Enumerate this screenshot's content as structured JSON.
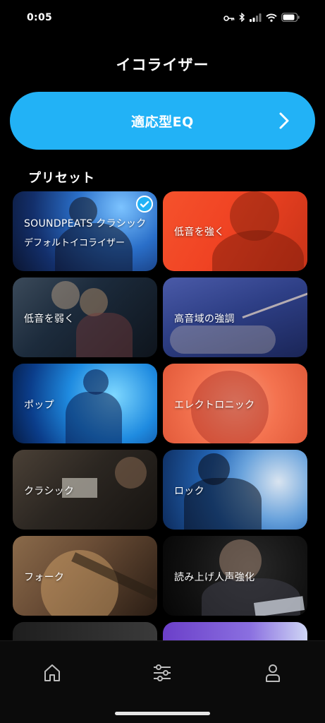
{
  "status_bar": {
    "time": "0:05"
  },
  "header": {
    "title": "イコライザー"
  },
  "adaptive_eq": {
    "label": "適応型EQ",
    "color": "#22b2f6"
  },
  "presets_section": {
    "title": "プリセット"
  },
  "presets": [
    {
      "label": "SOUNDPEATS クラシック",
      "sublabel": "デフォルトイコライザー",
      "selected": true,
      "tone": "#2a6fc9"
    },
    {
      "label": "低音を強く",
      "selected": false,
      "tone": "#f04323"
    },
    {
      "label": "低音を弱く",
      "selected": false,
      "tone": "#1c2b3c"
    },
    {
      "label": "高音域の強調",
      "selected": false,
      "tone": "#2e3f86"
    },
    {
      "label": "ポップ",
      "selected": false,
      "tone": "#1f8be0"
    },
    {
      "label": "エレクトロニック",
      "selected": false,
      "tone": "#f47350"
    },
    {
      "label": "クラシック",
      "selected": false,
      "tone": "#2b2621"
    },
    {
      "label": "ロック",
      "selected": false,
      "tone": "#2467b8"
    },
    {
      "label": "フォーク",
      "selected": false,
      "tone": "#6a4d36"
    },
    {
      "label": "読み上げ人声強化",
      "selected": false,
      "tone": "#121212"
    }
  ],
  "nav": {
    "items": [
      "home-icon",
      "sliders-icon",
      "profile-icon"
    ]
  }
}
